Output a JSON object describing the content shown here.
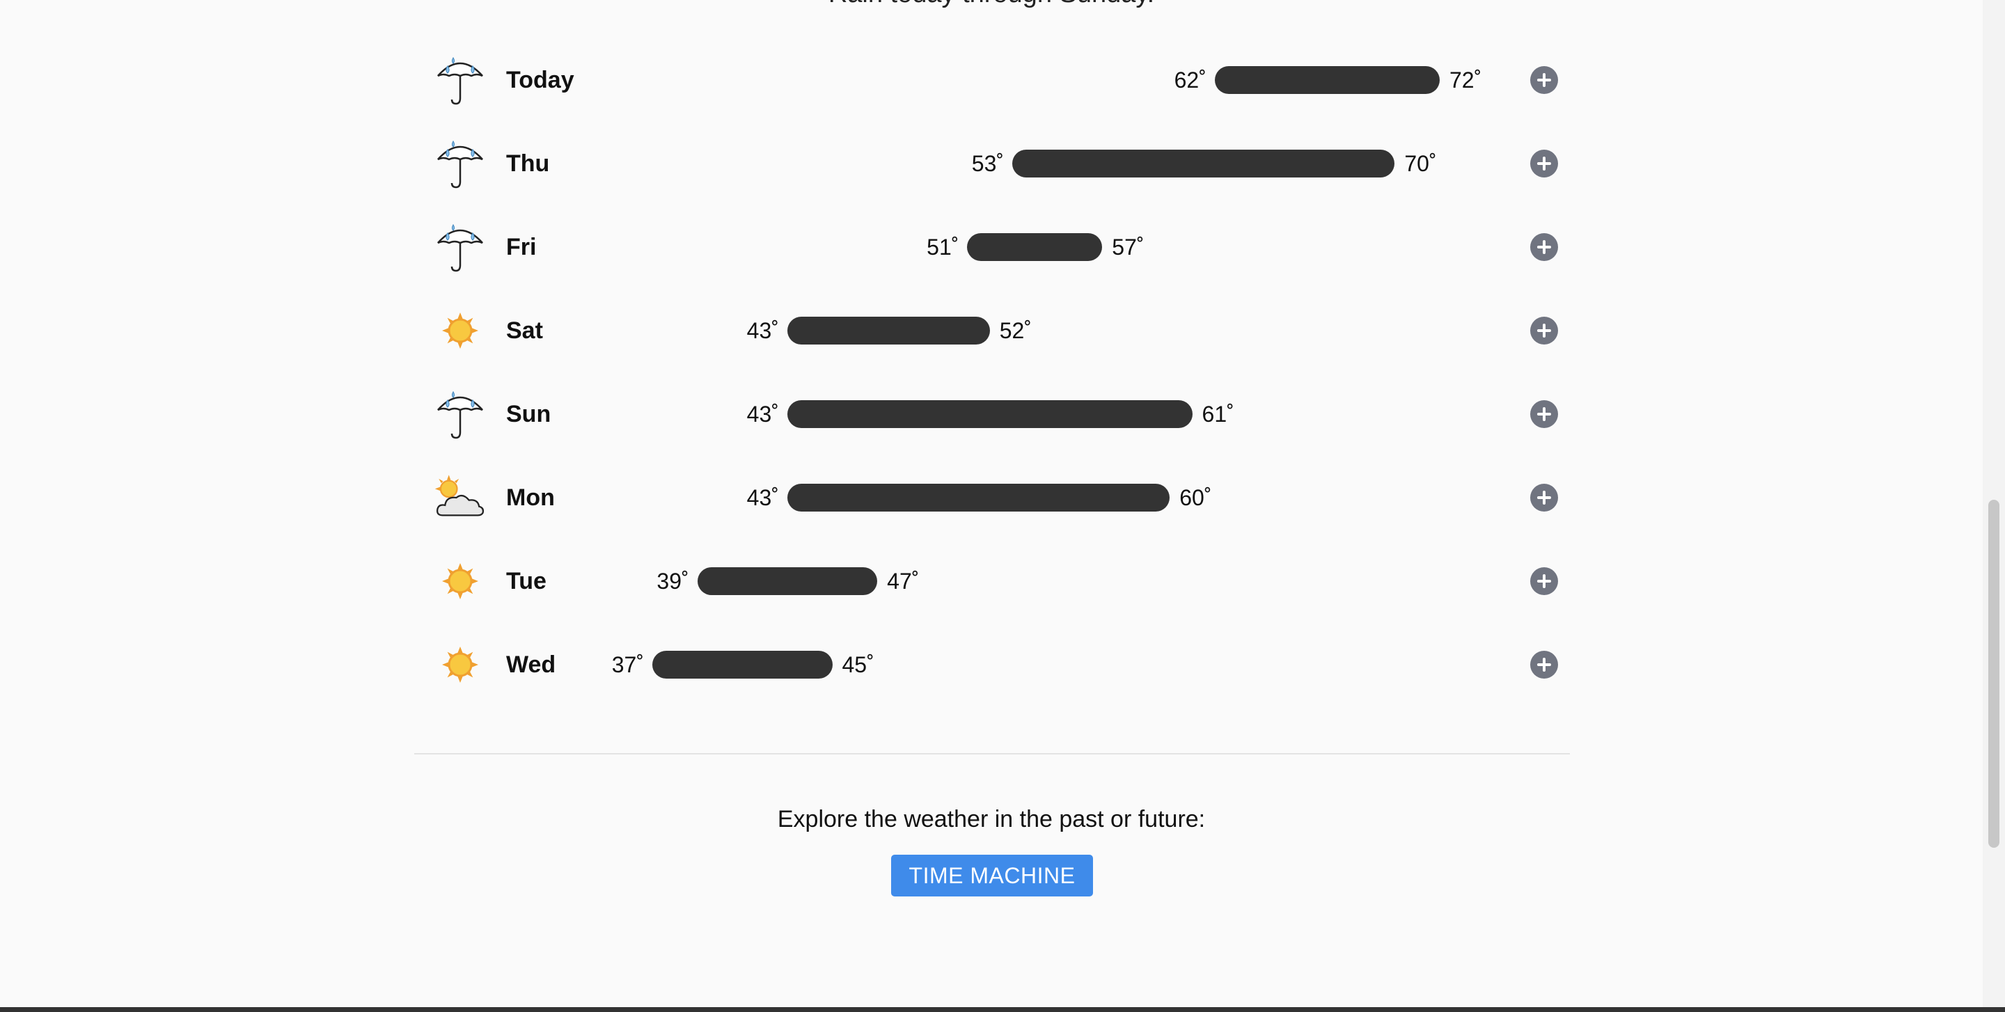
{
  "summary": "Rain today through Sunday.",
  "days": [
    {
      "name": "Today",
      "icon": "umbrella-rain-icon",
      "low": "62˚",
      "high": "72˚",
      "low_value": 62,
      "high_value": 72
    },
    {
      "name": "Thu",
      "icon": "umbrella-rain-icon",
      "low": "53˚",
      "high": "70˚",
      "low_value": 53,
      "high_value": 70
    },
    {
      "name": "Fri",
      "icon": "umbrella-rain-icon",
      "low": "51˚",
      "high": "57˚",
      "low_value": 51,
      "high_value": 57
    },
    {
      "name": "Sat",
      "icon": "sun-icon",
      "low": "43˚",
      "high": "52˚",
      "low_value": 43,
      "high_value": 52
    },
    {
      "name": "Sun",
      "icon": "umbrella-rain-icon",
      "low": "43˚",
      "high": "61˚",
      "low_value": 43,
      "high_value": 61
    },
    {
      "name": "Mon",
      "icon": "partly-cloudy-icon",
      "low": "43˚",
      "high": "60˚",
      "low_value": 43,
      "high_value": 60
    },
    {
      "name": "Tue",
      "icon": "sun-icon",
      "low": "39˚",
      "high": "47˚",
      "low_value": 39,
      "high_value": 47
    },
    {
      "name": "Wed",
      "icon": "sun-icon",
      "low": "37˚",
      "high": "45˚",
      "low_value": 37,
      "high_value": 45
    }
  ],
  "explore_text": "Explore the weather in the past or future:",
  "time_machine_label": "TIME MACHINE",
  "colors": {
    "bar": "#333333",
    "button": "#3f8bea",
    "expand_icon": "#707480",
    "sun": "#f5b43a"
  }
}
